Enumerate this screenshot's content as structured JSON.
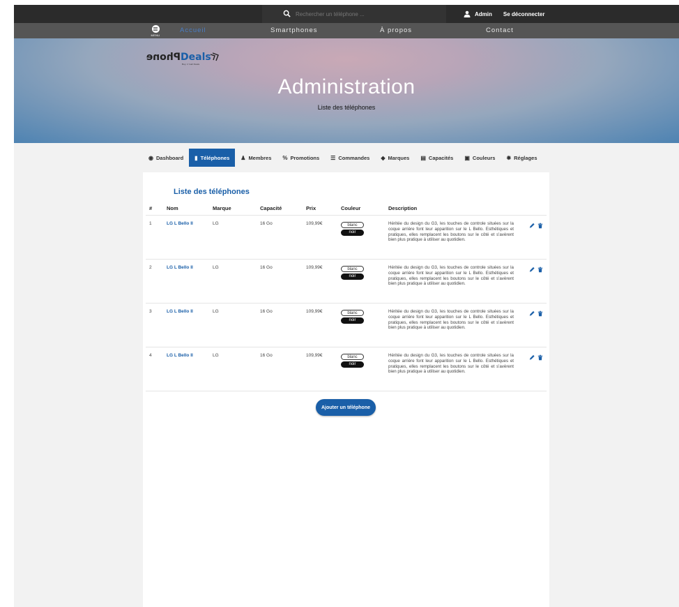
{
  "header": {
    "search_placeholder": "Rechercher un téléphone ...",
    "user_label": "Admin",
    "logout_label": "Se déconnecter"
  },
  "nav": {
    "menu_label": "MENU",
    "items": [
      {
        "label": "Accueil"
      },
      {
        "label": "Smartphones"
      },
      {
        "label": "À propos"
      },
      {
        "label": "Contact"
      }
    ]
  },
  "hero": {
    "logo_dark": "PhoneDeals",
    "logo_sub": "Buy n' Get Deals",
    "title": "Administration",
    "subtitle": "Liste des téléphones"
  },
  "tabs": [
    {
      "label": "Dashboard",
      "icon": "dashboard-icon"
    },
    {
      "label": "Téléphones",
      "icon": "phone-icon",
      "active": true
    },
    {
      "label": "Membres",
      "icon": "user-icon"
    },
    {
      "label": "Promotions",
      "icon": "percent-icon"
    },
    {
      "label": "Commandes",
      "icon": "list-icon"
    },
    {
      "label": "Marques",
      "icon": "tag-icon"
    },
    {
      "label": "Capacités",
      "icon": "storage-icon"
    },
    {
      "label": "Couleurs",
      "icon": "image-icon"
    },
    {
      "label": "Réglages",
      "icon": "gear-icon"
    }
  ],
  "table": {
    "title": "Liste des téléphones",
    "headers": {
      "num": "#",
      "name": "Nom",
      "brand": "Marque",
      "capacity": "Capacité",
      "price": "Prix",
      "color": "Couleur",
      "description": "Description"
    },
    "rows": [
      {
        "num": "1",
        "name": "LG L Bello II",
        "brand": "LG",
        "capacity": "16 Go",
        "price": "109,99€",
        "colors": [
          "blanc",
          "noir"
        ],
        "description": "Héritée du design du G3, les touches de controle situées sur la coque arrière font leur apparition sur le L Bello. Esthétiques et pratiques, elles remplacent les boutons sur le côté et s'avèrent bien plus pratique à utiliser au quotidien."
      },
      {
        "num": "2",
        "name": "LG L Bello II",
        "brand": "LG",
        "capacity": "16 Go",
        "price": "109,99€",
        "colors": [
          "blanc",
          "noir"
        ],
        "description": "Héritée du design du G3, les touches de controle situées sur la coque arrière font leur apparition sur le L Bello. Esthétiques et pratiques, elles remplacent les boutons sur le côté et s'avèrent bien plus pratique à utiliser au quotidien."
      },
      {
        "num": "3",
        "name": "LG L Bello II",
        "brand": "LG",
        "capacity": "16 Go",
        "price": "109,99€",
        "colors": [
          "blanc",
          "noir"
        ],
        "description": "Héritée du design du G3, les touches de controle situées sur la coque arrière font leur apparition sur le L Bello. Esthétiques et pratiques, elles remplacent les boutons sur le côté et s'avèrent bien plus pratique à utiliser au quotidien."
      },
      {
        "num": "4",
        "name": "LG L Bello II",
        "brand": "LG",
        "capacity": "16 Go",
        "price": "109,99€",
        "colors": [
          "blanc",
          "noir"
        ],
        "description": "Héritée du design du G3, les touches de controle situées sur la coque arrière font leur apparition sur le L Bello. Esthétiques et pratiques, elles remplacent les boutons sur le côté et s'avèrent bien plus pratique à utiliser au quotidien."
      }
    ]
  },
  "add_button_label": "Ajouter un téléphone",
  "colors": {
    "accent": "#1a5fa8",
    "topbar": "#2b2b2b",
    "navbar": "#555555"
  }
}
